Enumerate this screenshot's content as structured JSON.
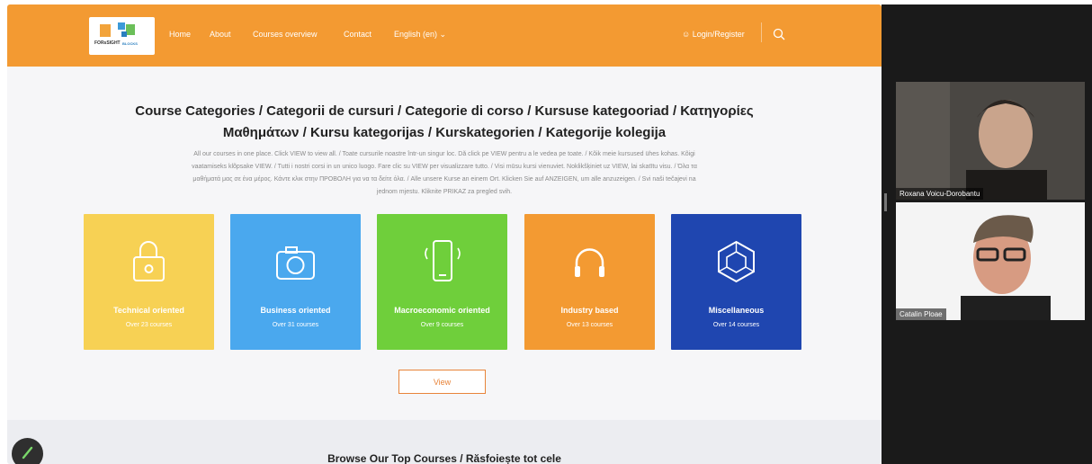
{
  "website": {
    "logo": {
      "line1": "FORsSIGHT",
      "line2": "BLOCKS"
    },
    "nav": {
      "home": "Home",
      "about": "About",
      "courses_overview": "Courses overview",
      "contact": "Contact",
      "language": "English (en)",
      "login": "Login/Register"
    },
    "title_line1": "Course Categories / Categorii de cursuri / Categorie di corso / Kursuse kategooriad / Κατηγορίες",
    "title_line2": "Μαθημάτων / Kursu kategorijas / Kurskategorien / Kategorije kolegija",
    "desc_line1": "All our courses in one place. Click VIEW to view all. / Toate cursurile noastre într-un singur loc. Dă click pe VIEW pentru a le vedea pe toate. / Kõik meie kursused ühes kohas. Kõigi",
    "desc_line2": "vaatamiseks klõpsake VIEW. / Tutti i nostri corsi in un unico luogo. Fare clic su VIEW per visualizzare tutto. / Visi mūsu kursi vienuviet. Noklikšķiniet uz VIEW, lai skatītu visu. / Όλα τα",
    "desc_line3": "μαθήματά μας σε ένα μέρος. Κάντε κλικ στην ΠΡΟΒΟΛΗ για να τα δείτε όλα. / Alle unsere Kurse an einem Ort. Klicken Sie auf ANZEIGEN, um alle anzuzeigen. / Svi naši tečajevi na",
    "desc_line4": "jednom mjestu. Kliknite PRIKAZ za pregled svih.",
    "categories": [
      {
        "name": "Technical oriented",
        "count": "Over 23 courses",
        "color": "#f7d154",
        "icon": "basket-icon"
      },
      {
        "name": "Business oriented",
        "count": "Over 31 courses",
        "color": "#4aa8ee",
        "icon": "camera-icon"
      },
      {
        "name": "Macroeconomic oriented",
        "count": "Over 9 courses",
        "color": "#6fcf3b",
        "icon": "phone-icon"
      },
      {
        "name": "Industry based",
        "count": "Over 13 courses",
        "color": "#f39a32",
        "icon": "headphones-icon"
      },
      {
        "name": "Miscellaneous",
        "count": "Over 14 courses",
        "color": "#1f46b0",
        "icon": "cube-icon"
      }
    ],
    "view_button": "View",
    "bottom_title": "Browse Our Top Courses / Răsfoiește tot cele"
  },
  "meeting": {
    "participants": [
      {
        "name": "Roxana Voicu-Dorobantu"
      },
      {
        "name": "Catalin Ploae"
      }
    ]
  },
  "colors": {
    "header": "#f39a32",
    "button_border": "#e8843a"
  }
}
